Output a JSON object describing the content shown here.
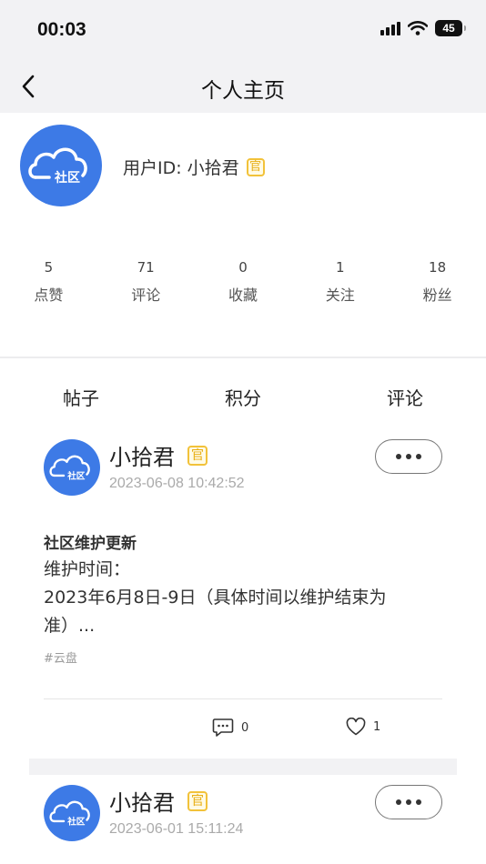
{
  "status_bar": {
    "time": "00:03",
    "battery": "45"
  },
  "nav": {
    "title": "个人主页"
  },
  "profile": {
    "user_label": "用户ID: 小拾君",
    "badge": "官",
    "avatar_text": "社区",
    "brand_color": "#3d7ae6",
    "stats": [
      {
        "value": "5",
        "label": "点赞"
      },
      {
        "value": "71",
        "label": "评论"
      },
      {
        "value": "0",
        "label": "收藏"
      },
      {
        "value": "1",
        "label": "关注"
      },
      {
        "value": "18",
        "label": "粉丝"
      }
    ]
  },
  "tabs": [
    {
      "label": "帖子"
    },
    {
      "label": "积分"
    },
    {
      "label": "评论"
    }
  ],
  "posts": [
    {
      "author": "小拾君",
      "badge": "官",
      "time": "2023-06-08 10:42:52",
      "title": "社区维护更新",
      "body_lines": [
        "维护时间：",
        "2023年6月8日-9日（具体时间以维护结束为",
        "准）..."
      ],
      "tag": "#云盘",
      "comments": "0",
      "likes": "1"
    },
    {
      "author": "小拾君",
      "badge": "官",
      "time": "2023-06-01 15:11:24"
    }
  ],
  "icons": [
    "back-icon",
    "signal-icon",
    "wifi-icon",
    "battery-icon",
    "official-badge-icon",
    "more-icon",
    "comment-icon",
    "heart-icon"
  ]
}
